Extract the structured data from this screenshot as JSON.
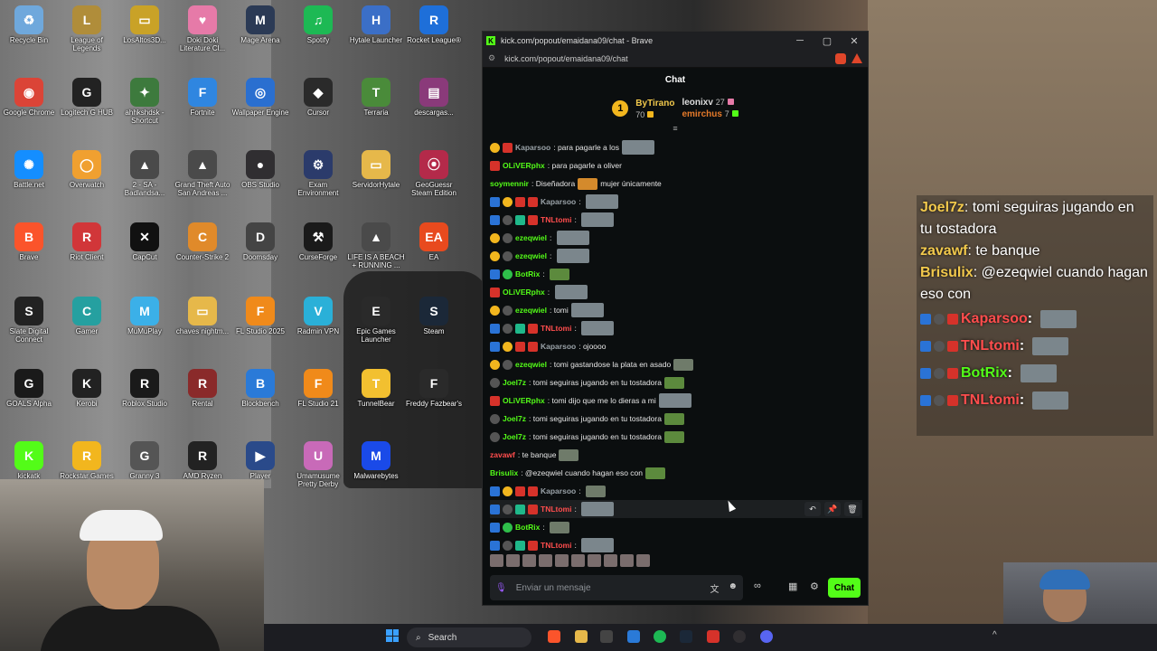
{
  "desktop": {
    "icons": [
      {
        "label": "Recycle Bin",
        "glyph": "♻",
        "color": "#6fa8dc"
      },
      {
        "label": "League of Legends",
        "glyph": "L",
        "color": "#b08d3a"
      },
      {
        "label": "LosAltos3D...",
        "glyph": "▭",
        "color": "#c9a227"
      },
      {
        "label": "Doki Doki Literature Cl...",
        "glyph": "♥",
        "color": "#e67aa8"
      },
      {
        "label": "Mage Arena",
        "glyph": "M",
        "color": "#2b3a55"
      },
      {
        "label": "Spotify",
        "glyph": "♫",
        "color": "#1db954"
      },
      {
        "label": "Hytale Launcher",
        "glyph": "H",
        "color": "#3b6fc7"
      },
      {
        "label": "Rocket League®",
        "glyph": "R",
        "color": "#1e6fd9"
      },
      {
        "label": "Google Chrome",
        "glyph": "◉",
        "color": "#db4437"
      },
      {
        "label": "Logitech G HUB",
        "glyph": "G",
        "color": "#222222"
      },
      {
        "label": "ahhkshdsk - Shortcut",
        "glyph": "✦",
        "color": "#3d7a3d"
      },
      {
        "label": "Fortnite",
        "glyph": "F",
        "color": "#2f86e0"
      },
      {
        "label": "Wallpaper Engine",
        "glyph": "◎",
        "color": "#2a6fd0"
      },
      {
        "label": "Cursor",
        "glyph": "◆",
        "color": "#2a2a2a"
      },
      {
        "label": "Terraria",
        "glyph": "T",
        "color": "#4a8b3a"
      },
      {
        "label": "descargas...",
        "glyph": "▤",
        "color": "#8a3a7a"
      },
      {
        "label": "Battle.net",
        "glyph": "✺",
        "color": "#148eff"
      },
      {
        "label": "Overwatch",
        "glyph": "◯",
        "color": "#f0a030"
      },
      {
        "label": "2 - SA - Badlandsa...",
        "glyph": "▲",
        "color": "#4a4a4a"
      },
      {
        "label": "Grand Theft Auto San Andreas ...",
        "glyph": "▲",
        "color": "#4a4a4a"
      },
      {
        "label": "OBS Studio",
        "glyph": "●",
        "color": "#302e31"
      },
      {
        "label": "Exam Environment",
        "glyph": "⚙",
        "color": "#2b3b6b"
      },
      {
        "label": "ServidorHytale",
        "glyph": "▭",
        "color": "#e6b84a"
      },
      {
        "label": "GeoGuessr Steam Edition",
        "glyph": "⦿",
        "color": "#b42a4a"
      },
      {
        "label": "Brave",
        "glyph": "B",
        "color": "#fb542b"
      },
      {
        "label": "Riot Client",
        "glyph": "R",
        "color": "#d13639"
      },
      {
        "label": "CapCut",
        "glyph": "✕",
        "color": "#111111"
      },
      {
        "label": "Counter-Strike 2",
        "glyph": "C",
        "color": "#e08a2a"
      },
      {
        "label": "Doomsday",
        "glyph": "D",
        "color": "#444444"
      },
      {
        "label": "CurseForge",
        "glyph": "⚒",
        "color": "#1a1a1a"
      },
      {
        "label": "LIFE IS A BEACH + RUNNING ...",
        "glyph": "▲",
        "color": "#4a4a4a"
      },
      {
        "label": "EA",
        "glyph": "EA",
        "color": "#e84a1e"
      },
      {
        "label": "Slate Digital Connect",
        "glyph": "S",
        "color": "#222222"
      },
      {
        "label": "Gamer",
        "glyph": "C",
        "color": "#25a0a0"
      },
      {
        "label": "MuMuPlay",
        "glyph": "M",
        "color": "#3bb0e8"
      },
      {
        "label": "chaves nightm...",
        "glyph": "▭",
        "color": "#e6b84a"
      },
      {
        "label": "FL Studio 2025",
        "glyph": "F",
        "color": "#f08a1a"
      },
      {
        "label": "Radmin VPN",
        "glyph": "V",
        "color": "#2ab0d8"
      },
      {
        "label": "Epic Games Launcher",
        "glyph": "E",
        "color": "#2a2a2a"
      },
      {
        "label": "Steam",
        "glyph": "S",
        "color": "#1b2838"
      },
      {
        "label": "GOALS Alpha",
        "glyph": "G",
        "color": "#1a1a1a"
      },
      {
        "label": "Kerobi",
        "glyph": "K",
        "color": "#222222"
      },
      {
        "label": "Roblox Studio",
        "glyph": "R",
        "color": "#1a1a1a"
      },
      {
        "label": "Rental",
        "glyph": "R",
        "color": "#8a2a2a"
      },
      {
        "label": "Blockbench",
        "glyph": "B",
        "color": "#2a7ad8"
      },
      {
        "label": "FL Studio 21",
        "glyph": "F",
        "color": "#f08a1a"
      },
      {
        "label": "TunnelBear",
        "glyph": "T",
        "color": "#f2c030"
      },
      {
        "label": "Freddy Fazbear's",
        "glyph": "F",
        "color": "#2a2a2a"
      },
      {
        "label": "kickatk",
        "glyph": "K",
        "color": "#53fc18"
      },
      {
        "label": "Rockstar Games Launcher",
        "glyph": "R",
        "color": "#f2b61e"
      },
      {
        "label": "Granny 3",
        "glyph": "G",
        "color": "#555555"
      },
      {
        "label": "AMD Ryzen Master",
        "glyph": "R",
        "color": "#222222"
      },
      {
        "label": "Player",
        "glyph": "▶",
        "color": "#2a4a8a"
      },
      {
        "label": "Umamusume Pretty Derby",
        "glyph": "U",
        "color": "#c86ab8"
      },
      {
        "label": "Malwarebytes",
        "glyph": "M",
        "color": "#1a4ae8"
      }
    ]
  },
  "browser": {
    "title": "kick.com/popout/emaidana09/chat - Brave",
    "url": "kick.com/popout/emaidana09/chat",
    "minimize": "─",
    "maximize": "▢",
    "close": "✕"
  },
  "chat": {
    "header": "Chat",
    "pinned": {
      "rank1": {
        "badge": "1",
        "user": "ByTirano",
        "count": "70"
      },
      "rank2": {
        "user": "leonixv",
        "count": "27"
      },
      "rank3": {
        "user": "emirchus",
        "count": "7"
      }
    },
    "messages": [
      {
        "badges": [
          "gold",
          "red"
        ],
        "user": "Kaparsoo",
        "color": "#9aa2a8",
        "text": "para pagarle a los",
        "emote": "big"
      },
      {
        "badges": [
          "red"
        ],
        "user": "OLiVERphx",
        "color": "#53fc18",
        "text": "para pagarle a oliver"
      },
      {
        "badges": [],
        "user": "soymennir",
        "color": "#53fc18",
        "text": "Diseñadora",
        "emote": "orange",
        "text2": "mujer únicamente"
      },
      {
        "badges": [
          "blue",
          "gold",
          "red",
          "red"
        ],
        "user": "Kaparsoo",
        "color": "#9aa2a8",
        "text": "",
        "emote": "big"
      },
      {
        "badges": [
          "blue",
          "grey",
          "teal",
          "red"
        ],
        "user": "TNLtomi",
        "color": "#ff4d4d",
        "text": "",
        "emote": "big"
      },
      {
        "badges": [
          "gold",
          "grey"
        ],
        "user": "ezeqwiel",
        "color": "#53fc18",
        "text": "",
        "emote": "big"
      },
      {
        "badges": [
          "gold",
          "grey"
        ],
        "user": "ezeqwiel",
        "color": "#53fc18",
        "text": "",
        "emote": "big"
      },
      {
        "badges": [
          "blue",
          "green"
        ],
        "user": "BotRix",
        "color": "#53fc18",
        "text": "",
        "emote": "flag"
      },
      {
        "badges": [
          "red"
        ],
        "user": "OLiVERphx",
        "color": "#53fc18",
        "text": "",
        "emote": "big"
      },
      {
        "badges": [
          "gold",
          "grey"
        ],
        "user": "ezeqwiel",
        "color": "#53fc18",
        "text": "tomi",
        "emote": "big"
      },
      {
        "badges": [
          "blue",
          "grey",
          "teal",
          "red"
        ],
        "user": "TNLtomi",
        "color": "#ff4d4d",
        "text": "",
        "emote": "big"
      },
      {
        "badges": [
          "blue",
          "gold",
          "red",
          "red"
        ],
        "user": "Kaparsoo",
        "color": "#9aa2a8",
        "text": "ojoooo"
      },
      {
        "badges": [
          "gold",
          "grey"
        ],
        "user": "ezeqwiel",
        "color": "#53fc18",
        "text": "tomi gastandose la plata en asado",
        "emote": "normal"
      },
      {
        "badges": [
          "grey"
        ],
        "user": "Joel7z",
        "color": "#53fc18",
        "text": "tomi seguiras jugando en tu tostadora",
        "emote": "flag"
      },
      {
        "badges": [
          "red"
        ],
        "user": "OLiVERphx",
        "color": "#53fc18",
        "text": "tomi dijo que me lo dieras a mi",
        "emote": "big"
      },
      {
        "badges": [
          "grey"
        ],
        "user": "Joel7z",
        "color": "#53fc18",
        "text": "tomi seguiras jugando en tu tostadora",
        "emote": "flag"
      },
      {
        "badges": [
          "grey"
        ],
        "user": "Joel7z",
        "color": "#53fc18",
        "text": "tomi seguiras jugando en tu tostadora",
        "emote": "flag"
      },
      {
        "badges": [],
        "user": "zavawf",
        "color": "#ff4d4d",
        "text": "te banque",
        "emote": "normal"
      },
      {
        "badges": [],
        "user": "Brisulix",
        "color": "#53fc18",
        "text": "@ezeqwiel cuando hagan eso con",
        "emote": "flag"
      },
      {
        "badges": [
          "blue",
          "gold",
          "red",
          "red"
        ],
        "user": "Kaparsoo",
        "color": "#9aa2a8",
        "text": "",
        "emote": "normal"
      },
      {
        "badges": [
          "blue",
          "grey",
          "teal",
          "red"
        ],
        "user": "TNLtomi",
        "color": "#ff4d4d",
        "text": "",
        "emote": "big",
        "highlight": true
      },
      {
        "badges": [
          "blue",
          "green"
        ],
        "user": "BotRix",
        "color": "#53fc18",
        "text": "",
        "emote": "normal"
      },
      {
        "badges": [
          "blue",
          "grey",
          "teal",
          "red"
        ],
        "user": "TNLtomi",
        "color": "#ff4d4d",
        "text": "",
        "emote": "big"
      }
    ],
    "input": {
      "placeholder": "Enviar un mensaje"
    },
    "send_label": "Chat",
    "row_actions": {
      "reply": "↶",
      "pin": "📌",
      "delete": "🗑"
    }
  },
  "overlay": {
    "messages": [
      {
        "user": "Joel7z",
        "text": "tomi seguiras jugando en tu tostadora"
      },
      {
        "user": "zavawf",
        "text": "te banque"
      },
      {
        "user": "Brisulix",
        "text": "@ezeqwiel cuando hagan eso con"
      }
    ],
    "badge_rows": [
      {
        "user": "Kaparsoo",
        "color": "#ff4d4d"
      },
      {
        "user": "TNLtomi",
        "color": "#ff4d4d"
      },
      {
        "user": "BotRix",
        "color": "#53fc18"
      },
      {
        "user": "TNLtomi",
        "color": "#ff4d4d"
      }
    ]
  },
  "taskbar": {
    "search_label": "Search"
  },
  "colors": {
    "kick_green": "#53fc18",
    "chat_bg": "#0b0e0f",
    "sub_gold": "#f2b61e"
  }
}
